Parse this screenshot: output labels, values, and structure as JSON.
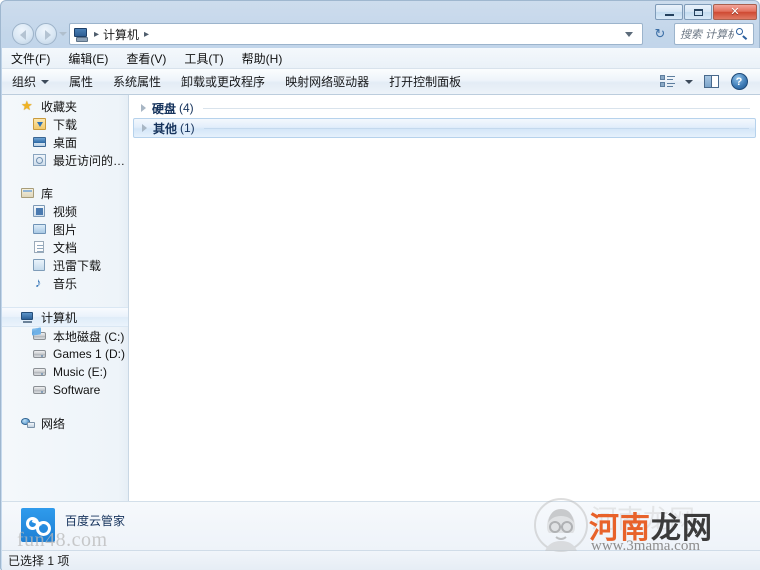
{
  "window": {
    "minimize_label": "最小化",
    "maximize_label": "最大化",
    "close_label": "✕"
  },
  "address": {
    "icon": "computer-icon",
    "crumb": "计算机",
    "separator": "▸",
    "refresh_label": "↻"
  },
  "search": {
    "placeholder": "搜索 计算机",
    "icon": "search-icon"
  },
  "menu": {
    "items": [
      {
        "label": "文件(F)"
      },
      {
        "label": "编辑(E)"
      },
      {
        "label": "查看(V)"
      },
      {
        "label": "工具(T)"
      },
      {
        "label": "帮助(H)"
      }
    ]
  },
  "toolbar": {
    "organize": "组织",
    "items": [
      {
        "label": "属性"
      },
      {
        "label": "系统属性"
      },
      {
        "label": "卸载或更改程序"
      },
      {
        "label": "映射网络驱动器"
      },
      {
        "label": "打开控制面板"
      }
    ],
    "views_icon": "views-icon",
    "preview_icon": "preview-pane-icon",
    "help_icon": "help-icon",
    "help_glyph": "?"
  },
  "sidebar": {
    "favorites": {
      "label": "收藏夹",
      "items": [
        {
          "label": "下载",
          "icon": "download-folder-icon"
        },
        {
          "label": "桌面",
          "icon": "desktop-icon"
        },
        {
          "label": "最近访问的位置",
          "icon": "recent-places-icon"
        }
      ]
    },
    "libraries": {
      "label": "库",
      "items": [
        {
          "label": "视频",
          "icon": "videos-icon"
        },
        {
          "label": "图片",
          "icon": "pictures-icon"
        },
        {
          "label": "文档",
          "icon": "documents-icon"
        },
        {
          "label": "迅雷下载",
          "icon": "thunder-download-icon"
        },
        {
          "label": "音乐",
          "icon": "music-icon"
        }
      ]
    },
    "computer": {
      "label": "计算机",
      "selected": true,
      "items": [
        {
          "label": "本地磁盘 (C:)",
          "icon": "system-drive-icon"
        },
        {
          "label": "Games 1 (D:)",
          "icon": "drive-icon"
        },
        {
          "label": "Music (E:)",
          "icon": "drive-icon"
        },
        {
          "label": "Software",
          "icon": "drive-icon"
        }
      ]
    },
    "network": {
      "label": "网络",
      "icon": "network-icon"
    }
  },
  "content": {
    "groups": [
      {
        "name": "硬盘",
        "count": "(4)",
        "selected": false
      },
      {
        "name": "其他",
        "count": "(1)",
        "selected": true
      }
    ]
  },
  "details": {
    "item_name": "百度云管家",
    "icon": "baidu-cloud-icon"
  },
  "status": {
    "text": "已选择 1 项"
  },
  "watermarks": {
    "bottom_left": "fun48.com",
    "brand_red": "河南",
    "brand_dark": "龙网",
    "url": "www.3mama.com",
    "ghost": "河南龙网"
  },
  "colors": {
    "accent": "#2b5f9e",
    "close_red": "#cf4a33",
    "group_text": "#16335c",
    "watermark_red": "#e8622a"
  }
}
